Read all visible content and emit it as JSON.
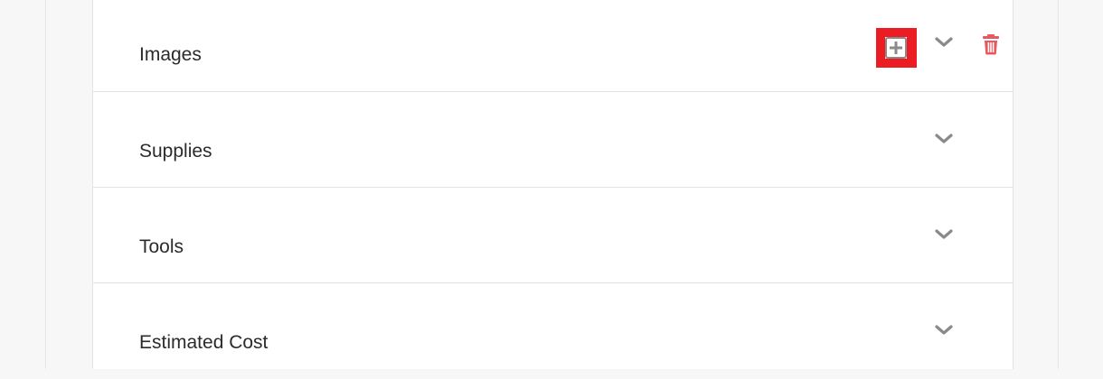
{
  "sections": [
    {
      "title": "Images"
    },
    {
      "title": "Supplies"
    },
    {
      "title": "Tools"
    },
    {
      "title": "Estimated Cost"
    }
  ],
  "icons": {
    "add": "plus-square-icon",
    "expand": "chevron-down-icon",
    "delete": "trash-icon"
  },
  "colors": {
    "highlight": "#ec1c24",
    "delete": "#e8585e",
    "icon": "#8a8a8a",
    "text": "#2b2b2b"
  }
}
